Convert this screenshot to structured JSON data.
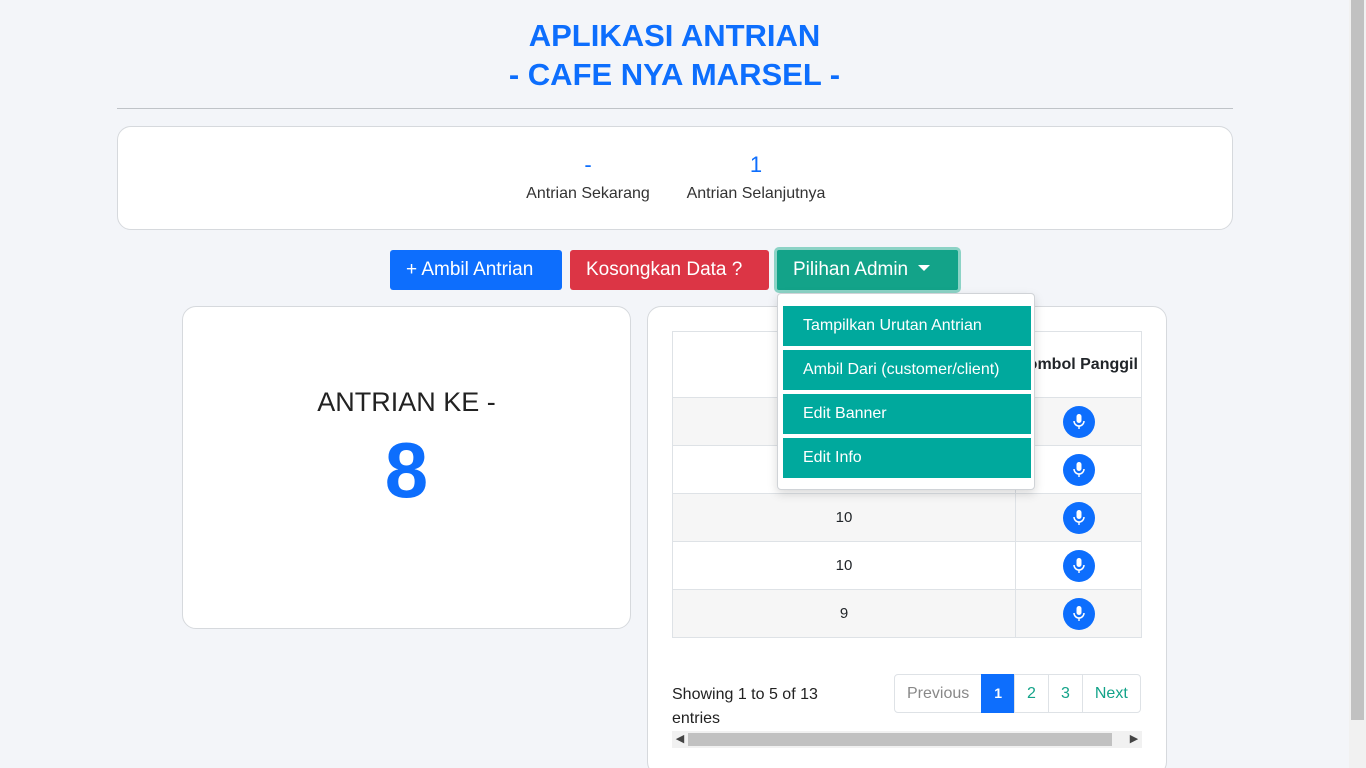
{
  "header": {
    "title_line1": "APLIKASI ANTRIAN",
    "title_line2": "- CAFE NYA MARSEL -"
  },
  "status": {
    "current_value": "-",
    "current_label": "Antrian Sekarang",
    "next_value": "1",
    "next_label": "Antrian Selanjutnya"
  },
  "actions": {
    "take_label": "+ Ambil Antrian",
    "clear_label": "Kosongkan Data ?",
    "admin_label": "Pilihan Admin"
  },
  "admin_menu": {
    "items": [
      {
        "label": "Tampilkan Urutan Antrian"
      },
      {
        "label": "Ambil Dari (customer/client)"
      },
      {
        "label": "Edit Banner"
      },
      {
        "label": "Edit Info"
      }
    ]
  },
  "queue": {
    "label": "ANTRIAN KE -",
    "number": "8"
  },
  "table": {
    "header_call": "Tombol Panggil",
    "rows": [
      {
        "value": ""
      },
      {
        "value": ""
      },
      {
        "value": "10"
      },
      {
        "value": "10"
      },
      {
        "value": "9"
      }
    ],
    "info": "Showing 1 to 5 of 13 entries",
    "pagination": {
      "previous": "Previous",
      "pages": [
        "1",
        "2",
        "3"
      ],
      "next": "Next"
    }
  },
  "colors": {
    "primary": "#0d6efd",
    "danger": "#dc3545",
    "admin": "#13a389",
    "menu_item": "#00a99d"
  },
  "icons": {
    "call_button": "microphone-icon",
    "dropdown": "caret-down-icon"
  }
}
